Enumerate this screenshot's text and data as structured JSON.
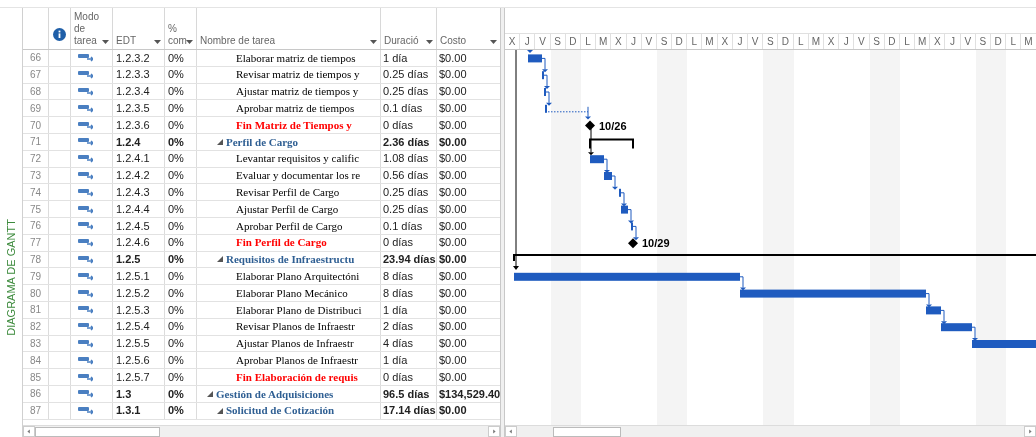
{
  "side_label": "DIAGRAMA DE GANTT",
  "columns": [
    {
      "kind": "number"
    },
    {
      "kind": "info"
    },
    {
      "kind": "text",
      "label": "Modo de tarea"
    },
    {
      "kind": "text",
      "label": "EDT"
    },
    {
      "kind": "text",
      "label": "% com"
    },
    {
      "kind": "text",
      "label": "Nombre de tarea"
    },
    {
      "kind": "text",
      "label": "Duració"
    },
    {
      "kind": "text",
      "label": "Costo"
    }
  ],
  "rows": [
    {
      "kind": "group",
      "children": [
        {
          "kind": "group",
          "children": [
            {
              "kind": "task",
              "id": "66",
              "wbs": "1.2.3.2",
              "complete": "0%",
              "name": "Elaborar matriz de tiempos",
              "duration": "1 día",
              "cost": "$0.00"
            },
            {
              "kind": "task",
              "id": "67",
              "wbs": "1.2.3.3",
              "complete": "0%",
              "name": "Revisar matriz de tiempos y",
              "duration": "0.25 días",
              "cost": "$0.00"
            },
            {
              "kind": "task",
              "id": "68",
              "wbs": "1.2.3.4",
              "complete": "0%",
              "name": "Ajustar matriz de tiempos y",
              "duration": "0.25 días",
              "cost": "$0.00"
            },
            {
              "kind": "task",
              "id": "69",
              "wbs": "1.2.3.5",
              "complete": "0%",
              "name": "Aprobar matriz de tiempos",
              "duration": "0.1 días",
              "cost": "$0.00"
            },
            {
              "kind": "milestone",
              "id": "70",
              "wbs": "1.2.3.6",
              "complete": "0%",
              "name": "Fin Matriz de Tiempos y",
              "duration": "0 días",
              "cost": "$0.00",
              "gantt_label": "10/26"
            }
          ]
        },
        {
          "kind": "summary",
          "expanded": true,
          "id": "71",
          "wbs": "1.2.4",
          "complete": "0%",
          "name": "Perfil de Cargo",
          "duration": "2.36 días",
          "cost": "$0.00",
          "children": [
            {
              "kind": "task",
              "id": "72",
              "wbs": "1.2.4.1",
              "complete": "0%",
              "name": "Levantar requisitos y calific",
              "duration": "1.08 días",
              "cost": "$0.00"
            },
            {
              "kind": "task",
              "id": "73",
              "wbs": "1.2.4.2",
              "complete": "0%",
              "name": "Evaluar y documentar los re",
              "duration": "0.56 días",
              "cost": "$0.00"
            },
            {
              "kind": "task",
              "id": "74",
              "wbs": "1.2.4.3",
              "complete": "0%",
              "name": "Revisar Perfil de Cargo",
              "duration": "0.25 días",
              "cost": "$0.00"
            },
            {
              "kind": "task",
              "id": "75",
              "wbs": "1.2.4.4",
              "complete": "0%",
              "name": "Ajustar Perfil de Cargo",
              "duration": "0.25 días",
              "cost": "$0.00"
            },
            {
              "kind": "task",
              "id": "76",
              "wbs": "1.2.4.5",
              "complete": "0%",
              "name": "Aprobar Perfil de Cargo",
              "duration": "0.1 días",
              "cost": "$0.00"
            },
            {
              "kind": "milestone",
              "id": "77",
              "wbs": "1.2.4.6",
              "complete": "0%",
              "name": "Fin Perfil de Cargo",
              "duration": "0 días",
              "cost": "$0.00",
              "gantt_label": "10/29"
            }
          ]
        },
        {
          "kind": "summary",
          "expanded": true,
          "id": "78",
          "wbs": "1.2.5",
          "complete": "0%",
          "name": "Requisitos de Infraestructu",
          "duration": "23.94 días",
          "cost": "$0.00",
          "children": [
            {
              "kind": "task",
              "id": "79",
              "wbs": "1.2.5.1",
              "complete": "0%",
              "name": "Elaborar Plano Arquitectóni",
              "duration": "8 días",
              "cost": "$0.00"
            },
            {
              "kind": "task",
              "id": "80",
              "wbs": "1.2.5.2",
              "complete": "0%",
              "name": "Elaborar Plano Mecánico",
              "duration": "8 días",
              "cost": "$0.00"
            },
            {
              "kind": "task",
              "id": "81",
              "wbs": "1.2.5.3",
              "complete": "0%",
              "name": "Elaborar Plano de Distribuci",
              "duration": "1 día",
              "cost": "$0.00"
            },
            {
              "kind": "task",
              "id": "82",
              "wbs": "1.2.5.4",
              "complete": "0%",
              "name": "Revisar Planos de Infraestr",
              "duration": "2 días",
              "cost": "$0.00"
            },
            {
              "kind": "task",
              "id": "83",
              "wbs": "1.2.5.5",
              "complete": "0%",
              "name": "Ajustar Planos de Infraestr",
              "duration": "4 días",
              "cost": "$0.00"
            },
            {
              "kind": "task",
              "id": "84",
              "wbs": "1.2.5.6",
              "complete": "0%",
              "name": "Aprobar Planos de Infraestr",
              "duration": "1 día",
              "cost": "$0.00"
            },
            {
              "kind": "milestone",
              "id": "85",
              "wbs": "1.2.5.7",
              "complete": "0%",
              "name": "Fin Elaboración de requis",
              "duration": "0 días",
              "cost": "$0.00"
            }
          ]
        }
      ]
    },
    {
      "kind": "summary",
      "expanded": true,
      "id": "86",
      "wbs": "1.3",
      "complete": "0%",
      "name": "Gestión de Adquisiciones",
      "duration": "96.5 días",
      "cost": "$134,529.40",
      "children": [
        {
          "kind": "summary",
          "expanded": true,
          "id": "87",
          "wbs": "1.3.1",
          "complete": "0%",
          "name": "Solicitud de Cotización",
          "duration": "17.14 días",
          "cost": "$0.00"
        }
      ]
    }
  ],
  "timescale": [
    {
      "label": "X",
      "weekend": false
    },
    {
      "label": "J",
      "weekend": false
    },
    {
      "label": "V",
      "weekend": false
    },
    {
      "label": "S",
      "weekend": true
    },
    {
      "label": "D",
      "weekend": true
    },
    {
      "label": "L",
      "weekend": false
    },
    {
      "label": "M",
      "weekend": false
    },
    {
      "label": "X",
      "weekend": false
    },
    {
      "label": "J",
      "weekend": false
    },
    {
      "label": "V",
      "weekend": false
    },
    {
      "label": "S",
      "weekend": true
    },
    {
      "label": "D",
      "weekend": true
    },
    {
      "label": "L",
      "weekend": false
    },
    {
      "label": "M",
      "weekend": false
    },
    {
      "label": "X",
      "weekend": false
    },
    {
      "label": "J",
      "weekend": false
    },
    {
      "label": "V",
      "weekend": false
    },
    {
      "label": "S",
      "weekend": true
    },
    {
      "label": "D",
      "weekend": true
    },
    {
      "label": "L",
      "weekend": false
    },
    {
      "label": "M",
      "weekend": false
    },
    {
      "label": "X",
      "weekend": false
    },
    {
      "label": "J",
      "weekend": false
    },
    {
      "label": "V",
      "weekend": false
    },
    {
      "label": "S",
      "weekend": true
    },
    {
      "label": "D",
      "weekend": true
    },
    {
      "label": "L",
      "weekend": false
    },
    {
      "label": "M",
      "weekend": false
    },
    {
      "label": "X",
      "weekend": false
    },
    {
      "label": "J",
      "weekend": false
    },
    {
      "label": "V",
      "weekend": false
    },
    {
      "label": "S",
      "weekend": true
    },
    {
      "label": "D",
      "weekend": true
    },
    {
      "label": "L",
      "weekend": false
    },
    {
      "label": "M",
      "weekend": false
    }
  ]
}
